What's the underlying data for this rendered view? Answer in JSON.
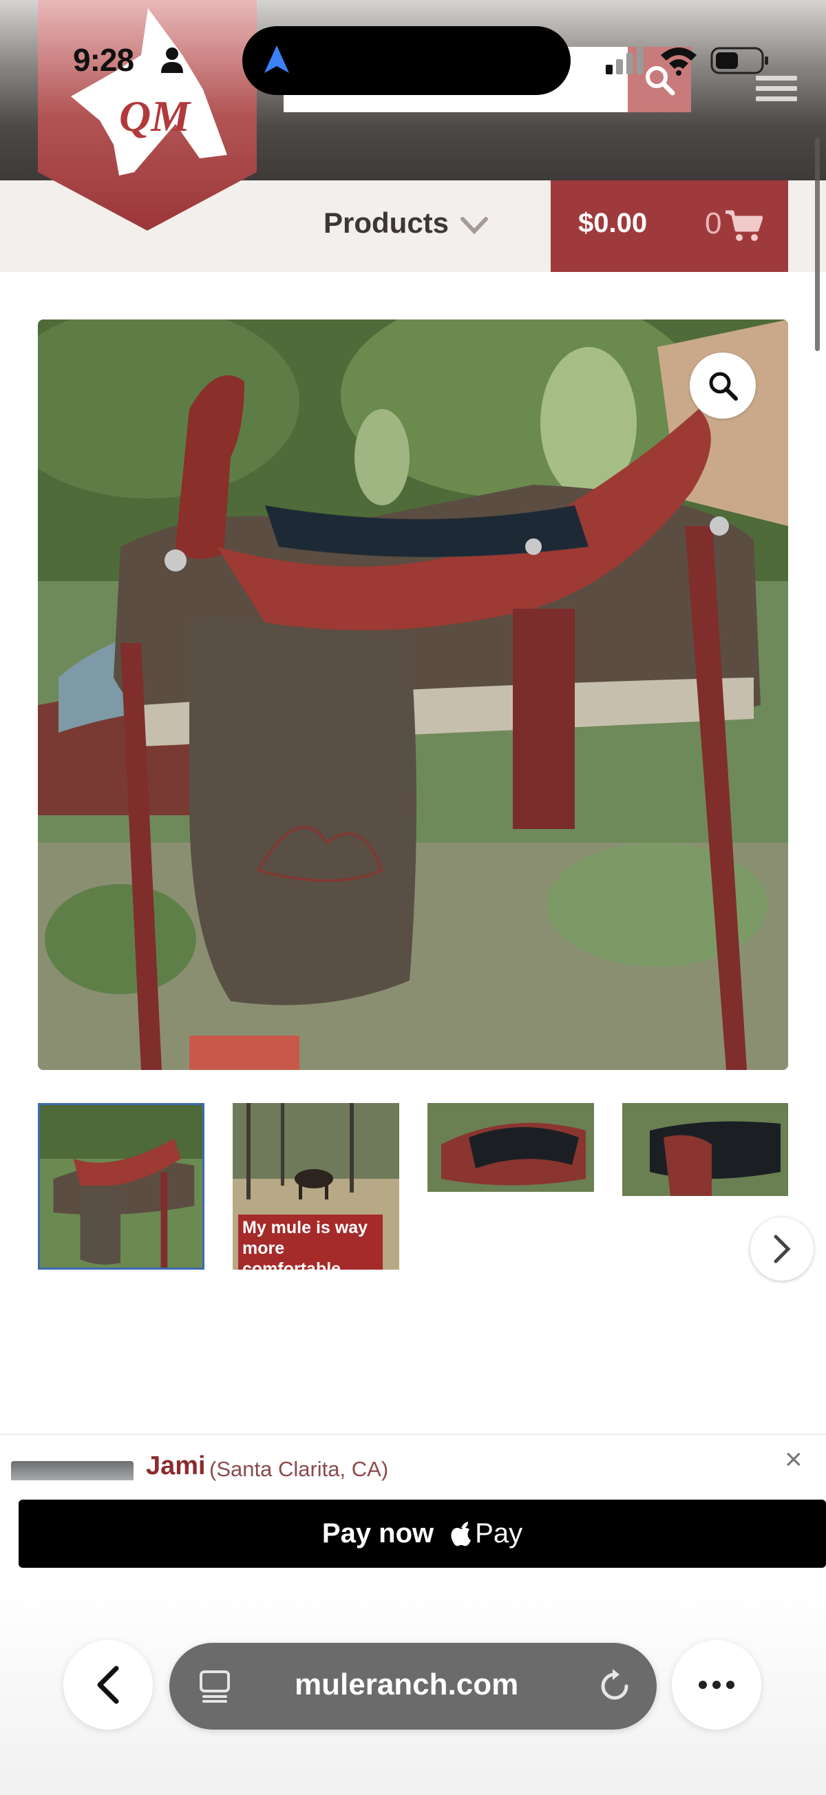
{
  "status_bar": {
    "time": "9:28"
  },
  "header": {
    "logo_text": "QM"
  },
  "nav": {
    "products_label": "Products",
    "cart_total": "$0.00",
    "cart_count": "0"
  },
  "gallery": {
    "thumb2_caption": "My mule is way more comfortable with your saddle"
  },
  "review": {
    "name": "Jami",
    "location": "(Santa Clarita, CA)",
    "close": "×"
  },
  "pay": {
    "label": "Pay now",
    "apple_pay": "Pay"
  },
  "browser": {
    "url": "muleranch.com"
  },
  "colors": {
    "brand": "#9f3a3c",
    "accent": "#3e6ab0"
  }
}
